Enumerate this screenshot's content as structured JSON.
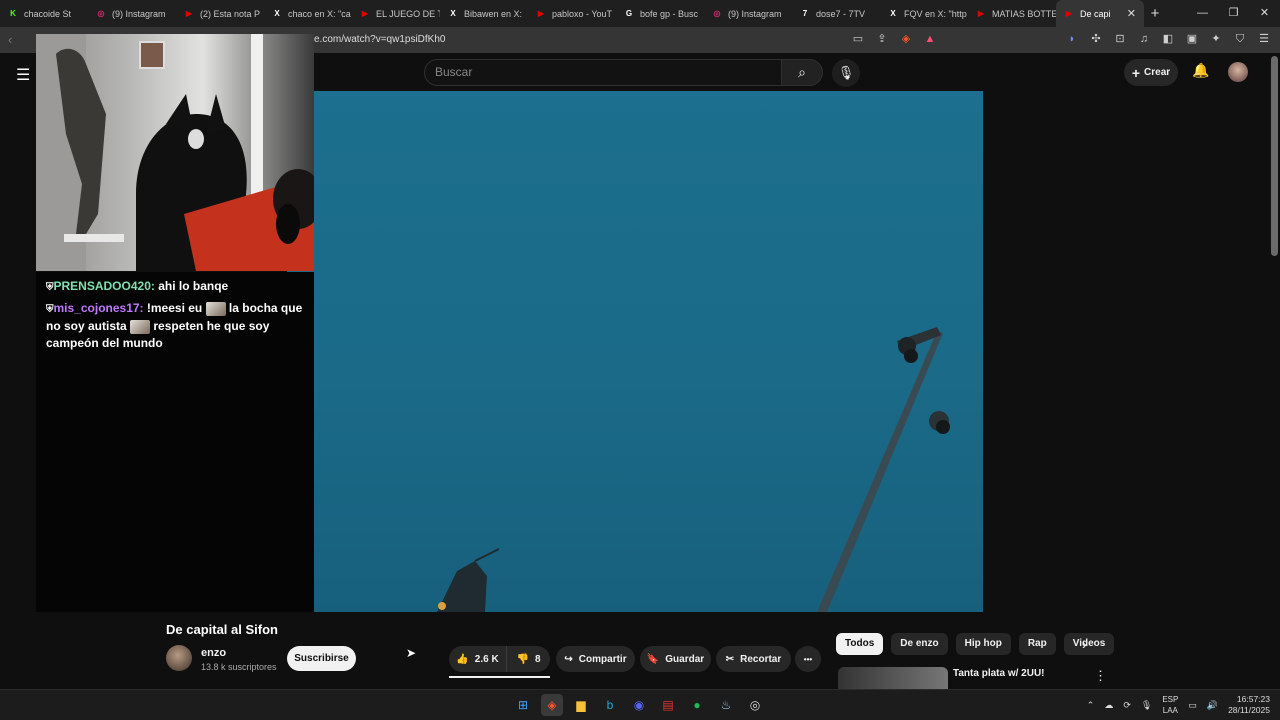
{
  "browser": {
    "tabs": [
      {
        "label": "chacoide St",
        "icon": "kick-icon",
        "color": "#53fc18"
      },
      {
        "label": "(9) Instagram",
        "icon": "instagram-icon",
        "color": "#d62976"
      },
      {
        "label": "(2) Esta nota P",
        "icon": "youtube-icon",
        "color": "#e00000"
      },
      {
        "label": "chaco en X: \"ca",
        "icon": "x-icon",
        "color": "#ffffff"
      },
      {
        "label": "EL JUEGO DE T",
        "icon": "youtube-icon",
        "color": "#e00000"
      },
      {
        "label": "Bibawen en X: ",
        "icon": "x-icon",
        "color": "#ffffff"
      },
      {
        "label": "pabloxo - YouT",
        "icon": "youtube-icon",
        "color": "#e00000"
      },
      {
        "label": "bofe gp - Busc",
        "icon": "google-icon",
        "color": "#ffffff"
      },
      {
        "label": "(9) Instagram",
        "icon": "instagram-icon",
        "color": "#d62976"
      },
      {
        "label": "dose7 - 7TV",
        "icon": "7tv-icon",
        "color": "#ffffff"
      },
      {
        "label": "FQV en X: \"http",
        "icon": "x-icon",
        "color": "#ffffff"
      },
      {
        "label": "MATIAS BOTTE",
        "icon": "youtube-icon",
        "color": "#e00000"
      },
      {
        "label": "De capi",
        "icon": "youtube-icon",
        "color": "#e00000",
        "active": true
      }
    ],
    "url": "e.com/watch?v=qw1psiDfKh0"
  },
  "header": {
    "search_placeholder": "Buscar",
    "create_label": "Crear"
  },
  "chat": [
    {
      "user": "PRENSADOO420:",
      "text": " ahi lo banqe"
    },
    {
      "user": "mis_cojones17:",
      "text_a": " !meesi eu ",
      "text_b": " la bocha que no soy autista ",
      "text_c": " respeten he que soy campeón del mundo"
    }
  ],
  "video": {
    "title": "De capital al Sifon",
    "channel": "enzo",
    "subscribers": "13.8 k suscriptores",
    "subscribe_label": "Suscribirse",
    "likes": "2.6 K",
    "dislikes": "8",
    "share_label": "Compartir",
    "save_label": "Guardar",
    "clip_label": "Recortar",
    "more_label": "•••"
  },
  "chips": [
    "Todos",
    "De enzo",
    "Hip hop",
    "Rap",
    "Videos"
  ],
  "recommended": {
    "title": "Tanta plata w/ 2UU!"
  },
  "taskbar": {
    "language": "ESP",
    "layout": "LAA",
    "time": "16:57:23",
    "date": "28/11/2025"
  }
}
